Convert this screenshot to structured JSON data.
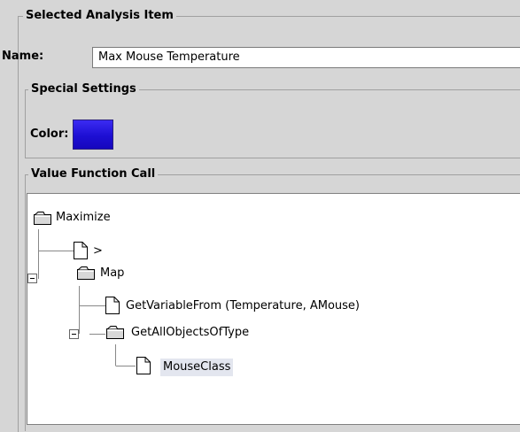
{
  "panel": {
    "title": "Selected Analysis Item",
    "name_label": "Name:",
    "name_value": "Max Mouse Temperature"
  },
  "special_settings": {
    "title": "Special Settings",
    "color_label": "Color:",
    "color_value": "#2414dc"
  },
  "value_function": {
    "title": "Value Function Call",
    "tree": [
      {
        "label": "Maximize",
        "type": "folder",
        "expanded": true
      },
      {
        "label": ">",
        "type": "leaf"
      },
      {
        "label": "Map",
        "type": "folder",
        "expanded": true
      },
      {
        "label": "GetVariableFrom (Temperature, AMouse)",
        "type": "leaf"
      },
      {
        "label": "GetAllObjectsOfType",
        "type": "folder",
        "expanded": true
      },
      {
        "label": "MouseClass",
        "type": "leaf",
        "selected": true
      }
    ]
  }
}
